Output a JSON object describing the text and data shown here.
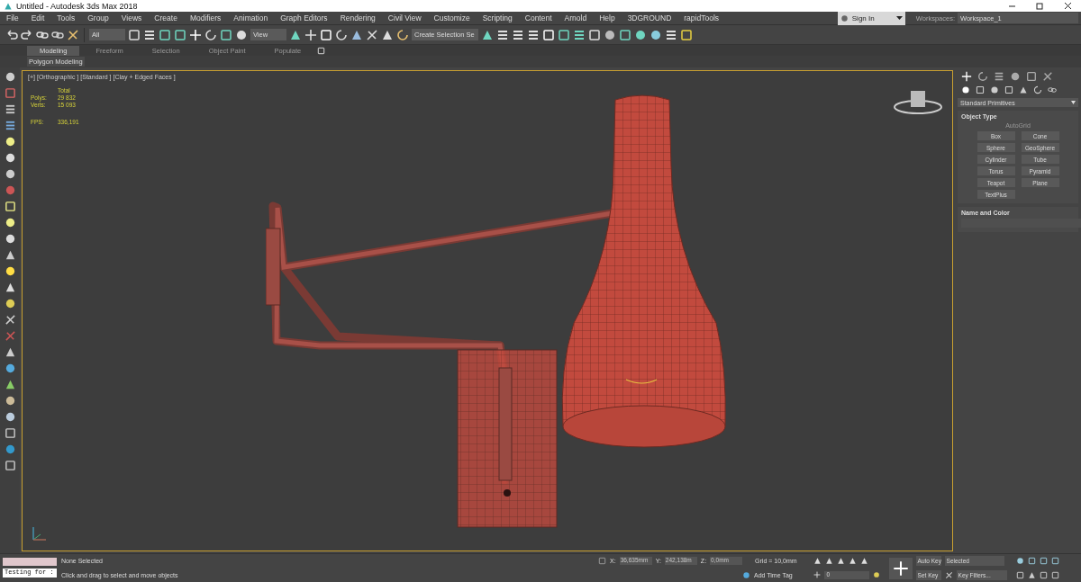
{
  "window": {
    "title": "Untitled - Autodesk 3ds Max 2018"
  },
  "menu": [
    {
      "label": "File"
    },
    {
      "label": "Edit"
    },
    {
      "label": "Tools"
    },
    {
      "label": "Group"
    },
    {
      "label": "Views"
    },
    {
      "label": "Create"
    },
    {
      "label": "Modifiers"
    },
    {
      "label": "Animation"
    },
    {
      "label": "Graph Editors"
    },
    {
      "label": "Rendering"
    },
    {
      "label": "Civil View"
    },
    {
      "label": "Customize"
    },
    {
      "label": "Scripting"
    },
    {
      "label": "Content"
    },
    {
      "label": "Arnold"
    },
    {
      "label": "Help"
    },
    {
      "label": "3DGROUND"
    },
    {
      "label": "rapidTools"
    }
  ],
  "account": {
    "sign_in": "Sign In",
    "workspaces_label": "Workspaces:",
    "workspace": "Workspace_1"
  },
  "toolbar": {
    "selection_filter": "All",
    "reference_coordinate": "View",
    "named_selection": "Create Selection Se"
  },
  "ribbon": {
    "tabs": [
      {
        "label": "Modeling",
        "selected": true
      },
      {
        "label": "Freeform",
        "selected": false
      },
      {
        "label": "Selection",
        "selected": false
      },
      {
        "label": "Object Paint",
        "selected": false
      },
      {
        "label": "Populate",
        "selected": false
      }
    ],
    "panel": "Polygon Modeling"
  },
  "viewport": {
    "labels": [
      "[+]",
      "[Orthographic ]",
      "[Standard ]",
      "[Clay + Edged Faces ]"
    ],
    "stats_header": "Total",
    "stats": [
      {
        "label": "Polys:",
        "value": "29 832"
      },
      {
        "label": "Verts:",
        "value": "15 093"
      }
    ],
    "fps": {
      "label": "FPS:",
      "value": "336,191"
    }
  },
  "command_panel": {
    "category": "Standard Primitives",
    "object_type": {
      "title": "Object Type",
      "autogrid": "AutoGrid",
      "autogrid_disabled": true,
      "buttons": [
        "Box",
        "Cone",
        "Sphere",
        "GeoSphere",
        "Cylinder",
        "Tube",
        "Torus",
        "Pyramid",
        "Teapot",
        "Plane",
        "TextPlus"
      ]
    },
    "name_and_color": {
      "title": "Name and Color"
    }
  },
  "status": {
    "script_field": "Testing for :",
    "selection": "None Selected",
    "prompt": "Click and drag to select and move objects",
    "x": {
      "label": "X:",
      "value": "36,635mm"
    },
    "y": {
      "label": "Y:",
      "value": "242,138m"
    },
    "z": {
      "label": "Z:",
      "value": "0,0mm"
    },
    "grid": "Grid = 10,0mm",
    "time_tag": "Add Time Tag",
    "frame": "0",
    "auto_key": "Auto Key",
    "key_mode": "Selected",
    "set_key": "Set Key",
    "key_filters": "Key Filters..."
  }
}
